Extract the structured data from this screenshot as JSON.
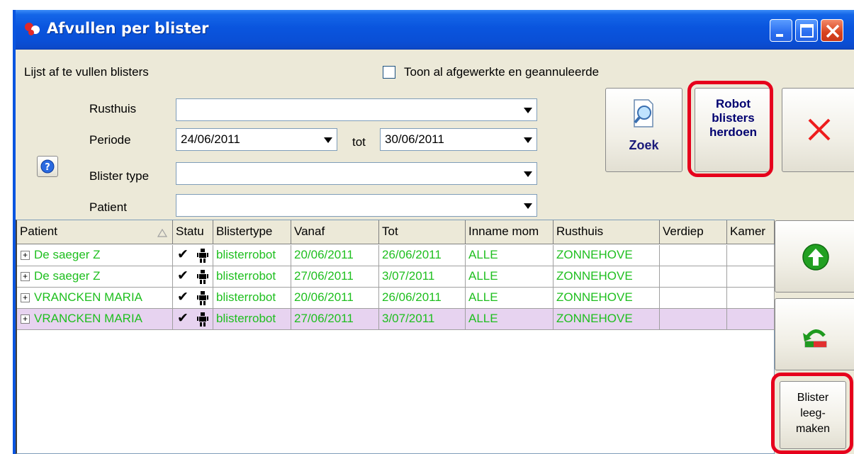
{
  "window": {
    "title": "Afvullen per blister",
    "accent": "#0a55de"
  },
  "filter": {
    "section_label": "Lijst af te vullen blisters",
    "show_finished_label": "Toon al afgewerkte en geannuleerde",
    "show_finished_checked": false,
    "rusthuis_label": "Rusthuis",
    "rusthuis_value": "",
    "periode_label": "Periode",
    "periode_from": "24/06/2011",
    "tot_label": "tot",
    "periode_to": "30/06/2011",
    "blistertype_label": "Blister type",
    "blistertype_value": "",
    "patient_label": "Patient",
    "patient_value": ""
  },
  "buttons": {
    "zoek": "Zoek",
    "robot_line1": "Robot",
    "robot_line2": "blisters",
    "robot_line3": "herdoen",
    "leeg_line1": "Blister",
    "leeg_line2": "leeg-",
    "leeg_line3": "maken"
  },
  "grid": {
    "columns": [
      "Patient",
      "Statu",
      "Blistertype",
      "Vanaf",
      "Tot",
      "Inname mom",
      "Rusthuis",
      "Verdiep",
      "Kamer"
    ],
    "rows": [
      {
        "patient": "De saeger Z",
        "status": "✔",
        "blistertype": "blisterrobot",
        "vanaf": "20/06/2011",
        "tot": "26/06/2011",
        "inname": "ALLE",
        "rusthuis": "ZONNEHOVE",
        "verdiep": "",
        "kamer": ""
      },
      {
        "patient": "De saeger Z",
        "status": "✔",
        "blistertype": "blisterrobot",
        "vanaf": "27/06/2011",
        "tot": "3/07/2011",
        "inname": "ALLE",
        "rusthuis": "ZONNEHOVE",
        "verdiep": "",
        "kamer": ""
      },
      {
        "patient": "VRANCKEN MARIA",
        "status": "✔",
        "blistertype": "blisterrobot",
        "vanaf": "20/06/2011",
        "tot": "26/06/2011",
        "inname": "ALLE",
        "rusthuis": "ZONNEHOVE",
        "verdiep": "",
        "kamer": ""
      },
      {
        "patient": "VRANCKEN MARIA",
        "status": "✔",
        "blistertype": "blisterrobot",
        "vanaf": "27/06/2011",
        "tot": "3/07/2011",
        "inname": "ALLE",
        "rusthuis": "ZONNEHOVE",
        "verdiep": "",
        "kamer": ""
      }
    ],
    "selected_row": 3,
    "row_text_color": "#1fbf1f",
    "selected_row_color": "#e7d3f0"
  },
  "icons": {
    "app": "app-pills-icon",
    "help": "help-icon",
    "zoek": "magnifier-icon",
    "cancel": "red-x-icon",
    "up": "green-up-arrow-icon",
    "undo": "undo-arrow-icon",
    "robot": "robot-icon",
    "sort": "sort-triangle-icon"
  }
}
